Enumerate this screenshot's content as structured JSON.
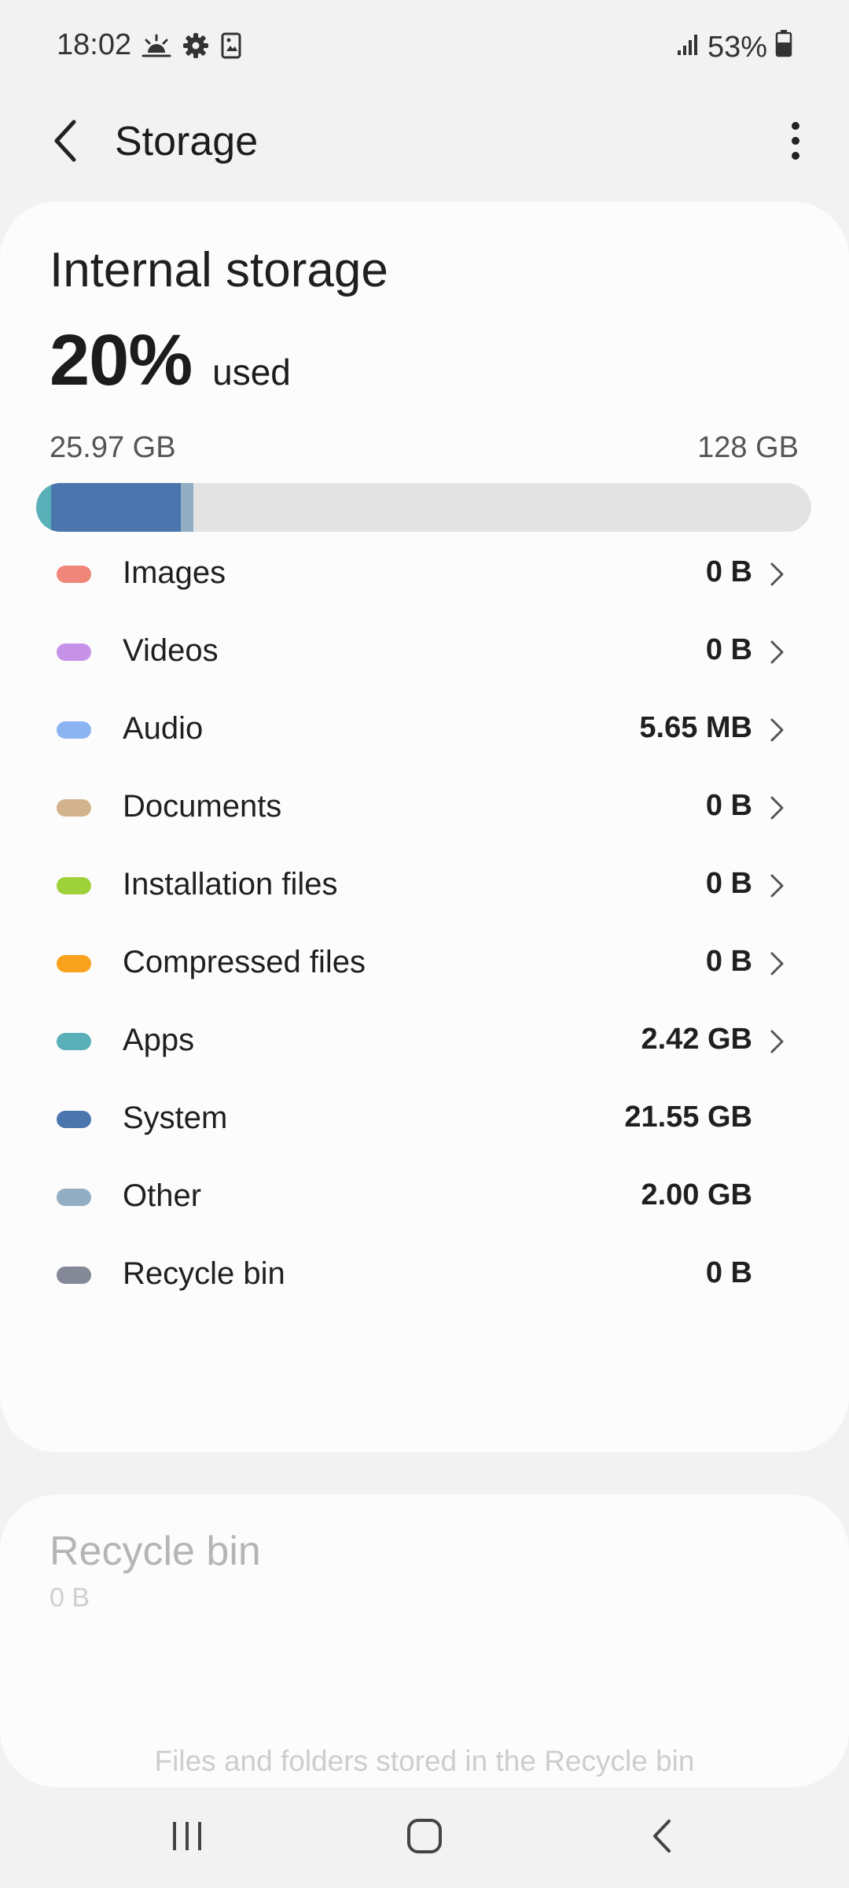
{
  "status_bar": {
    "time": "18:02",
    "left_icons": [
      "weather-icon",
      "settings-gear-icon",
      "screenshot-icon"
    ],
    "signal_icon": "signal-bars-icon",
    "battery_percent": "53%",
    "battery_icon": "battery-icon"
  },
  "app_bar": {
    "title": "Storage",
    "back_icon": "back-arrow-icon",
    "more_icon": "more-options-icon"
  },
  "internal_storage": {
    "title": "Internal storage",
    "used_percent": "20%",
    "used_suffix": "used",
    "used_amount": "25.97 GB",
    "total_amount": "128 GB",
    "usage_bar": [
      {
        "name": "Apps",
        "fraction": 0.019,
        "color": "#5ab0b8"
      },
      {
        "name": "System",
        "fraction": 0.168,
        "color": "#4a76ad"
      },
      {
        "name": "Other",
        "fraction": 0.016,
        "color": "#93adc2"
      }
    ]
  },
  "categories": [
    {
      "label": "Images",
      "size": "0 B",
      "color": "#f0867a",
      "chevron": true
    },
    {
      "label": "Videos",
      "size": "0 B",
      "color": "#c592e8",
      "chevron": true
    },
    {
      "label": "Audio",
      "size": "5.65 MB",
      "color": "#8db4f2",
      "chevron": true
    },
    {
      "label": "Documents",
      "size": "0 B",
      "color": "#d2b38d",
      "chevron": true
    },
    {
      "label": "Installation files",
      "size": "0 B",
      "color": "#9fd13b",
      "chevron": true
    },
    {
      "label": "Compressed files",
      "size": "0 B",
      "color": "#f8a21d",
      "chevron": true
    },
    {
      "label": "Apps",
      "size": "2.42 GB",
      "color": "#5ab0b8",
      "chevron": true
    },
    {
      "label": "System",
      "size": "21.55 GB",
      "color": "#4a76ad",
      "chevron": false
    },
    {
      "label": "Other",
      "size": "2.00 GB",
      "color": "#93adc2",
      "chevron": false
    },
    {
      "label": "Recycle bin",
      "size": "0 B",
      "color": "#858896",
      "chevron": false
    }
  ],
  "recycle_bin_card": {
    "title": "Recycle bin",
    "size": "0 B",
    "description": "Files and folders stored in the Recycle bin"
  },
  "nav_bar": {
    "recents_icon": "recent-apps-icon",
    "home_icon": "home-icon",
    "back_icon": "nav-back-icon"
  }
}
